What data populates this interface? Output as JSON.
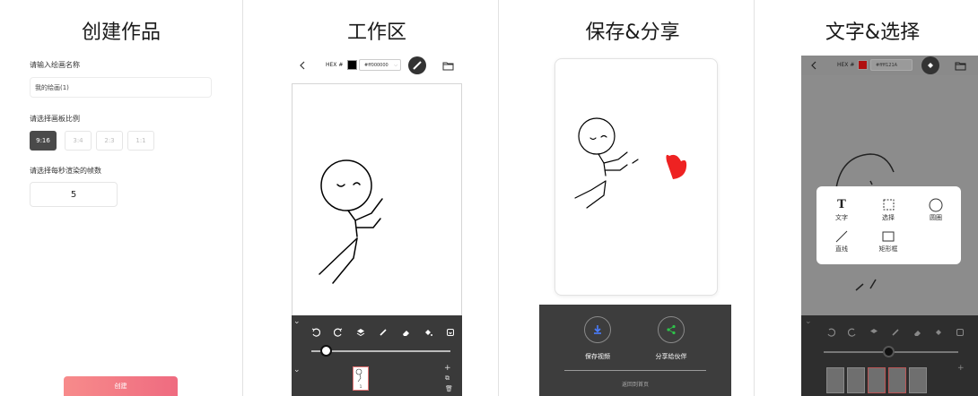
{
  "panel1": {
    "title": "创建作品",
    "name_label": "请输入绘画名称",
    "name_value": "我的绘画(1)",
    "ratio_label": "请选择画板比例",
    "ratios": [
      "9:16",
      "3:4",
      "2:3",
      "1:1"
    ],
    "selected_ratio": "9:16",
    "fps_label": "请选择每秒渲染的帧数",
    "fps_value": "5",
    "create_label": "创建"
  },
  "panel2": {
    "title": "工作区",
    "hex_label": "HEX #",
    "hex_value": "#ff000000",
    "brush_color": "#000000",
    "frame_number": "1",
    "slider_fraction": 0.1,
    "icons": [
      "back-icon",
      "swatch",
      "brush-icon",
      "folder-icon",
      "undo-icon",
      "redo-icon",
      "layers-icon",
      "pen-icon",
      "eraser-icon",
      "fill-icon",
      "export-icon"
    ]
  },
  "panel3": {
    "title": "保存&分享",
    "save_label": "保存视频",
    "share_label": "分享给伙伴",
    "home_label": "返回到首页",
    "heart_color": "#ee2222"
  },
  "panel4": {
    "title": "文字&选择",
    "hex_label": "HEX #",
    "hex_value": "#ffff121A",
    "brush_color": "#cc1010",
    "menu": [
      {
        "label": "文字",
        "icon": "text-icon"
      },
      {
        "label": "选择",
        "icon": "selection-icon"
      },
      {
        "label": "圆圈",
        "icon": "circle-icon"
      },
      {
        "label": "直线",
        "icon": "line-icon"
      },
      {
        "label": "矩形框",
        "icon": "rectangle-icon"
      }
    ]
  },
  "colors": {
    "accent": "#ef6b80",
    "dark_panel": "#3a3a3a"
  }
}
